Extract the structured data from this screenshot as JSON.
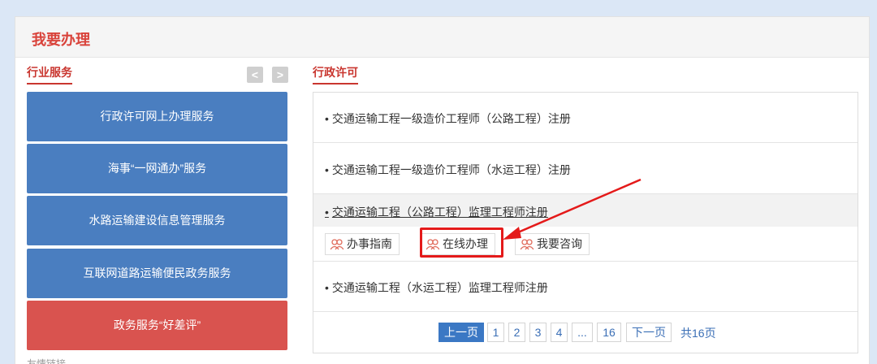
{
  "panel": {
    "title": "我要办理"
  },
  "left": {
    "section_title": "行业服务",
    "prev_arrow": "<",
    "next_arrow": ">",
    "buttons": [
      "行政许可网上办理服务",
      "海事“一网通办”服务",
      "水路运输建设信息管理服务",
      "互联网道路运输便民政务服务",
      "政务服务“好差评”"
    ],
    "tail_label": "友情链接"
  },
  "right": {
    "section_title": "行政许可",
    "bullet": "•",
    "items": [
      "交通运输工程一级造价工程师（公路工程）注册",
      "交通运输工程一级造价工程师（水运工程）注册",
      "交通运输工程（公路工程）监理工程师注册",
      "交通运输工程（水运工程）监理工程师注册"
    ],
    "actions": [
      "办事指南",
      "在线办理",
      "我要咨询"
    ],
    "pagination": {
      "prev": "上一页",
      "pages": [
        "1",
        "2",
        "3",
        "4",
        "...",
        "16"
      ],
      "next": "下一页",
      "total": "共16页"
    }
  },
  "colors": {
    "accent_red": "#d9433b",
    "button_blue": "#4a7ec0",
    "button_red": "#d9534f",
    "highlight": "#e41a1a"
  }
}
